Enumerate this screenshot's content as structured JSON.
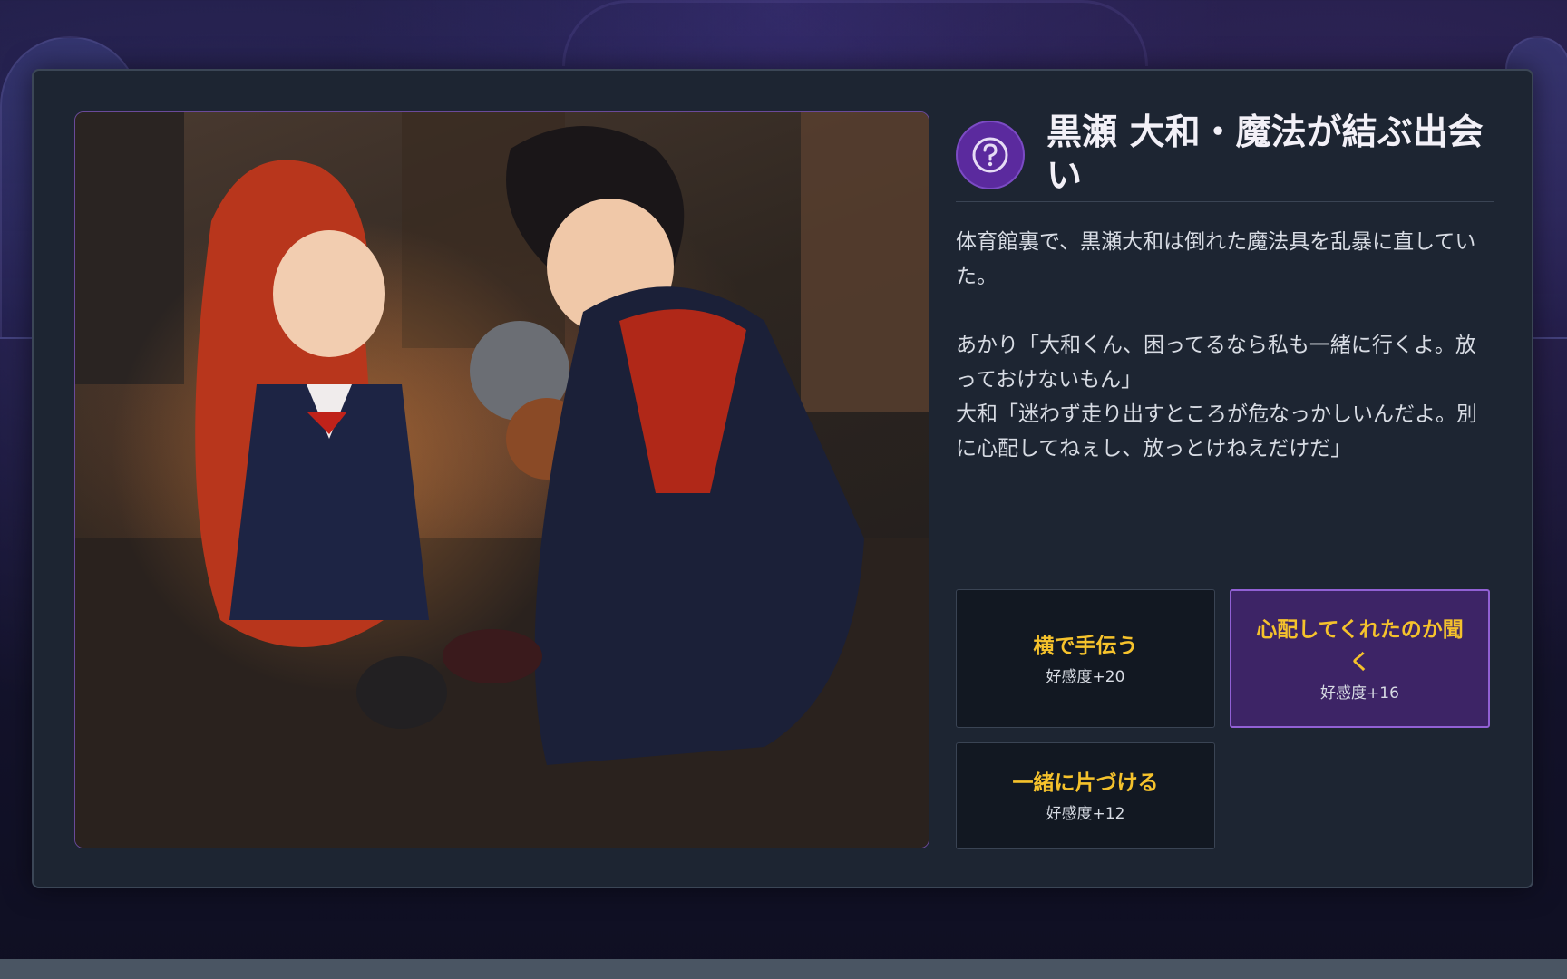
{
  "scene": {
    "title": "黒瀬 大和・魔法が結ぶ出会い",
    "icon": "question-icon",
    "narration": [
      "体育館裏で、黒瀬大和は倒れた魔法具を乱暴に直していた。",
      "",
      "あかり「大和くん、困ってるなら私も一緒に行くよ。放っておけないもん」",
      "大和「迷わず走り出すところが危なっかしいんだよ。別に心配してねぇし、放っとけねえだけだ」"
    ]
  },
  "choices": [
    {
      "label": "横で手伝う",
      "effect": "好感度+20"
    },
    {
      "label": "心配してくれたのか聞く",
      "effect": "好感度+16"
    },
    {
      "label": "一緒に片づける",
      "effect": "好感度+12"
    }
  ],
  "colors": {
    "accent": "#5b2a9e",
    "choice_text": "#f5c22c",
    "panel": "#1d2532"
  }
}
